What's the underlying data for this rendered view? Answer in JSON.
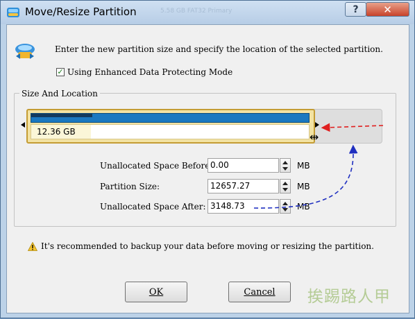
{
  "window": {
    "title": "Move/Resize Partition",
    "background_title_text": "5.58 GB FAT32 Primary",
    "help_glyph": "?",
    "close_glyph": "✕"
  },
  "intro": {
    "text": "Enter the new partition size and specify the location of the selected partition.",
    "checkbox_label": "Using Enhanced Data Protecting Mode",
    "checkbox_checked": true
  },
  "size_and_location": {
    "group_label": "Size And Location",
    "partition_size_label": "12.36 GB",
    "used_fraction": 0.81,
    "unallocated_fraction": 0.19
  },
  "fields": [
    {
      "label": "Unallocated Space Before:",
      "value": "0.00",
      "unit": "MB"
    },
    {
      "label": "Partition Size:",
      "value": "12657.27",
      "unit": "MB"
    },
    {
      "label": "Unallocated Space After:",
      "value": "3148.73",
      "unit": "MB"
    }
  ],
  "warning": {
    "text": "It's recommended to backup your data before moving or resizing the partition."
  },
  "buttons": {
    "ok": "OK",
    "cancel": "Cancel"
  },
  "watermark": "挨踢路人甲",
  "colors": {
    "used_bar": "#1a78c0",
    "partition_border": "#c49c34",
    "annotation_red": "#e02020",
    "annotation_blue": "#1f2fc0"
  }
}
